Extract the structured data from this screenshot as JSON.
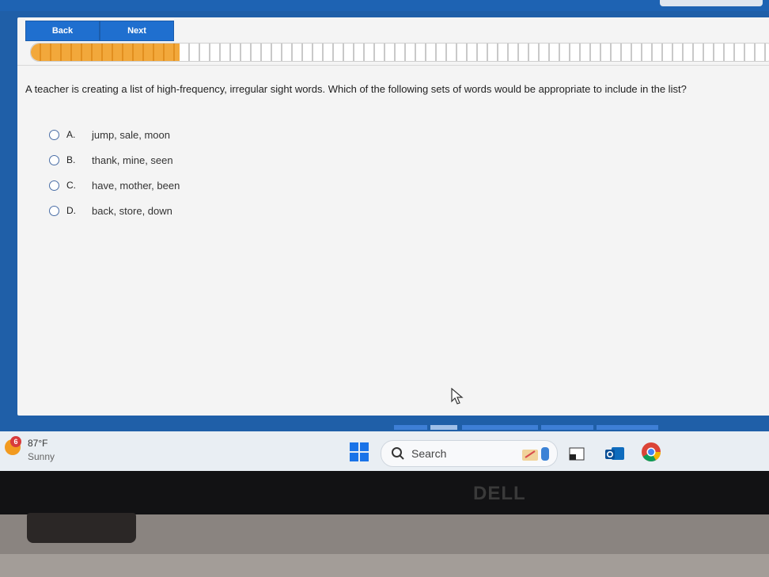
{
  "nav": {
    "back_label": "Back",
    "next_label": "Next"
  },
  "progress": {
    "fraction": 0.2
  },
  "question": "A teacher is creating a list of high-frequency, irregular sight words. Which of the following sets of words would be appropriate to include in the list?",
  "answers": [
    {
      "letter": "A.",
      "text": "jump, sale, moon"
    },
    {
      "letter": "B.",
      "text": "thank, mine, seen"
    },
    {
      "letter": "C.",
      "text": "have, mother, been"
    },
    {
      "letter": "D.",
      "text": "back, store, down"
    }
  ],
  "taskbar": {
    "weather_badge": "6",
    "temperature": "87°F",
    "condition": "Sunny",
    "search_label": "Search"
  },
  "device": {
    "brand": "DELL"
  },
  "colors": {
    "accent": "#1f6fcf",
    "progress": "#f2a83b",
    "header": "#1e63b3"
  }
}
